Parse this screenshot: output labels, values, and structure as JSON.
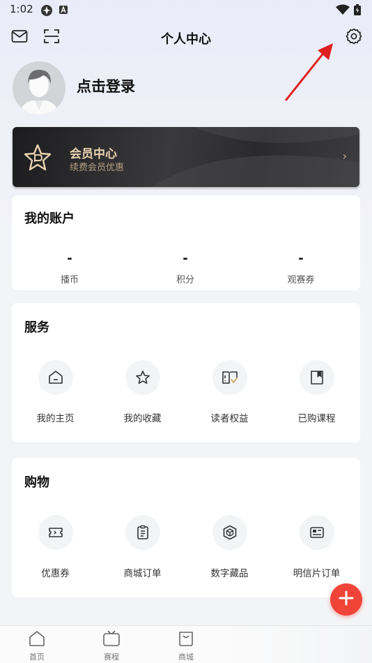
{
  "status_bar": {
    "time": "1:02"
  },
  "header": {
    "title": "个人中心"
  },
  "profile": {
    "login_text": "点击登录"
  },
  "vip": {
    "title": "会员中心",
    "subtitle": "续费会员优惠",
    "arrow": "›"
  },
  "account": {
    "title": "我的账户",
    "stats": [
      {
        "value": "-",
        "label": "播币"
      },
      {
        "value": "-",
        "label": "积分"
      },
      {
        "value": "-",
        "label": "观赛券"
      }
    ]
  },
  "services": {
    "title": "服务",
    "items": [
      {
        "label": "我的主页",
        "icon": "home-icon"
      },
      {
        "label": "我的收藏",
        "icon": "star-icon"
      },
      {
        "label": "读者权益",
        "icon": "reader-rights-icon"
      },
      {
        "label": "已购课程",
        "icon": "purchased-course-icon"
      }
    ]
  },
  "shopping": {
    "title": "购物",
    "items": [
      {
        "label": "优惠券",
        "icon": "coupon-icon"
      },
      {
        "label": "商城订单",
        "icon": "clipboard-icon"
      },
      {
        "label": "数字藏品",
        "icon": "cube-icon"
      },
      {
        "label": "明信片订单",
        "icon": "postcard-icon"
      }
    ]
  },
  "tabbar": {
    "items": [
      {
        "label": "首页",
        "icon": "home-tab-icon"
      },
      {
        "label": "赛程",
        "icon": "tv-icon"
      },
      {
        "label": "商城",
        "icon": "shopping-bag-icon"
      }
    ]
  },
  "colors": {
    "accent": "#f04438",
    "vip_gold": "#e8d3b0",
    "arrow_red": "#e02020"
  }
}
